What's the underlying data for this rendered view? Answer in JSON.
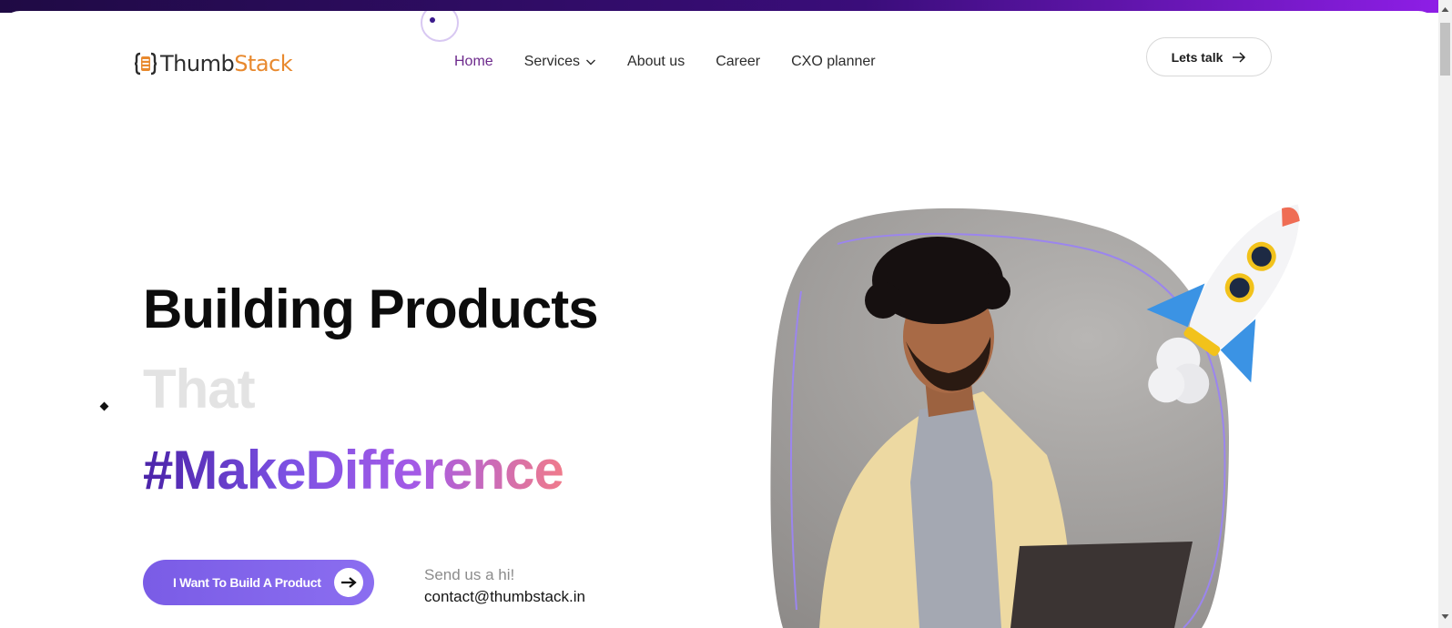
{
  "brand": {
    "part1": "Thumb",
    "part2": "Stack",
    "accent": "#e8892e"
  },
  "nav": {
    "items": [
      {
        "label": "Home",
        "active": true
      },
      {
        "label": "Services",
        "has_dropdown": true
      },
      {
        "label": "About us"
      },
      {
        "label": "Career"
      },
      {
        "label": "CXO planner"
      }
    ],
    "active_color": "#6d2a8c"
  },
  "header_cta": {
    "label": "Lets talk",
    "icon": "arrow-right-icon"
  },
  "hero": {
    "line1": "Building Products",
    "line2": "That",
    "line3": "#MakeDifference",
    "cta_label": "I Want To Build A Product",
    "cta_icon": "arrow-right-icon",
    "hi_label": "Send us a hi!",
    "email": "contact@thumbstack.in"
  },
  "colors": {
    "primary": "#7a5ce6",
    "gradient_end": "#f07b8b",
    "top_bar": "#3a0d7a"
  }
}
